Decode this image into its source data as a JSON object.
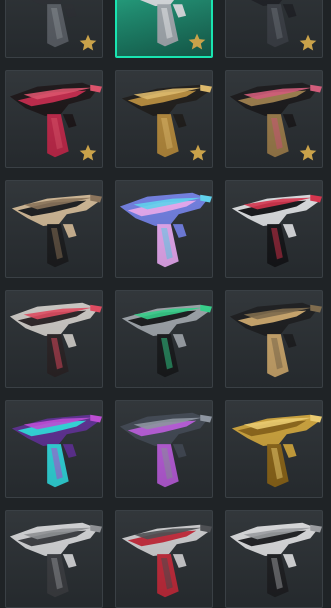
{
  "colors": {
    "background": "#1f2326",
    "tile": "#2a2f33",
    "tile_border": "#3a4045",
    "selected_border": "#19e4b0",
    "star": "#c9a24a"
  },
  "skins": [
    {
      "id": "r0c0",
      "primary": "#2b2e33",
      "accent": "#5a5f66",
      "trim": "#8a8f96",
      "favorite": true,
      "selected": false
    },
    {
      "id": "r0c1",
      "primary": "#d9dde0",
      "accent": "#a5acb2",
      "trim": "#f2f4f5",
      "favorite": true,
      "selected": true
    },
    {
      "id": "r0c2",
      "primary": "#1d1f24",
      "accent": "#3b3f46",
      "trim": "#6a6f77",
      "favorite": true,
      "selected": false
    },
    {
      "id": "r1c0",
      "primary": "#1a1416",
      "accent": "#c0284a",
      "trim": "#e0506a",
      "favorite": true,
      "selected": false
    },
    {
      "id": "r1c1",
      "primary": "#1d1b19",
      "accent": "#b58a3c",
      "trim": "#e2bc6a",
      "favorite": true,
      "selected": false
    },
    {
      "id": "r1c2",
      "primary": "#181719",
      "accent": "#9a7b4a",
      "trim": "#d65a7a",
      "favorite": true,
      "selected": false
    },
    {
      "id": "r2c0",
      "primary": "#cdb593",
      "accent": "#1b1c1e",
      "trim": "#8a7258",
      "favorite": false,
      "selected": false
    },
    {
      "id": "r2c1",
      "primary": "#6f7de0",
      "accent": "#e6a8f0",
      "trim": "#5ed6f2",
      "favorite": false,
      "selected": false
    },
    {
      "id": "r2c2",
      "primary": "#d8dadd",
      "accent": "#141518",
      "trim": "#d8304a",
      "favorite": false,
      "selected": false
    },
    {
      "id": "r3c0",
      "primary": "#c9c6c2",
      "accent": "#2a2325",
      "trim": "#e2485e",
      "favorite": false,
      "selected": false
    },
    {
      "id": "r3c1",
      "primary": "#9aa0a6",
      "accent": "#181a1c",
      "trim": "#32d28a",
      "favorite": false,
      "selected": false
    },
    {
      "id": "r3c2",
      "primary": "#1a1b1d",
      "accent": "#c8a46a",
      "trim": "#7e6a4a",
      "favorite": false,
      "selected": false
    },
    {
      "id": "r4c0",
      "primary": "#5a2d8e",
      "accent": "#2fd4d8",
      "trim": "#c04ad8",
      "favorite": false,
      "selected": false
    },
    {
      "id": "r4c1",
      "primary": "#3e4550",
      "accent": "#b55ad6",
      "trim": "#8e96a2",
      "favorite": false,
      "selected": false
    },
    {
      "id": "r4c2",
      "primary": "#c9a03a",
      "accent": "#8a6418",
      "trim": "#f0cf70",
      "favorite": false,
      "selected": false
    },
    {
      "id": "r5c0",
      "primary": "#cfd0d2",
      "accent": "#3a3c40",
      "trim": "#8e9094",
      "favorite": false,
      "selected": false
    },
    {
      "id": "r5c1",
      "primary": "#c9c9cb",
      "accent": "#c02a3a",
      "trim": "#4a4c50",
      "favorite": false,
      "selected": false
    },
    {
      "id": "r5c2",
      "primary": "#d6d7d9",
      "accent": "#1d1e21",
      "trim": "#9b9da1",
      "favorite": false,
      "selected": false
    }
  ]
}
